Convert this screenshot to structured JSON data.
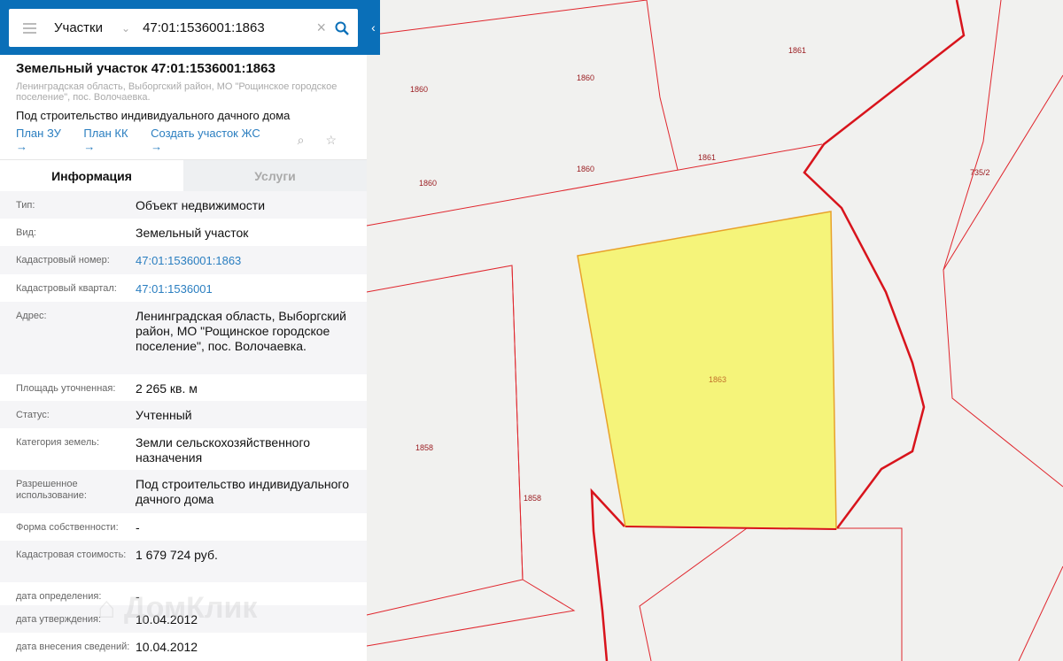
{
  "search": {
    "layer": "Участки",
    "query": "47:01:1536001:1863"
  },
  "header": {
    "title": "Земельный участок 47:01:1536001:1863",
    "address": "Ленинградская область, Выборгский район, МО \"Рощинское городское поселение\", пос. Волочаевка.",
    "purpose": "Под строительство индивидуального дачного дома",
    "links": [
      "План ЗУ →",
      "План КК →",
      "Создать участок ЖС →"
    ]
  },
  "tabs": [
    "Информация",
    "Услуги"
  ],
  "rows": [
    {
      "label": "Тип:",
      "value": "Объект недвижимости"
    },
    {
      "label": "Вид:",
      "value": "Земельный участок"
    },
    {
      "label": "Кадастровый номер:",
      "value": "47:01:1536001:1863",
      "link": true
    },
    {
      "label": "Кадастровый квартал:",
      "value": "47:01:1536001",
      "link": true
    },
    {
      "label": "Адрес:",
      "value": "Ленинградская область, Выборгский район, МО \"Рощинское городское поселение\", пос. Волочаевка."
    },
    {
      "label": "Площадь уточненная:",
      "value": "2 265 кв. м"
    },
    {
      "label": "Статус:",
      "value": "Учтенный"
    },
    {
      "label": "Категория земель:",
      "value": "Земли сельскохозяйственного назначения"
    },
    {
      "label": "Разрешенное использование:",
      "value": "Под строительство индивидуального дачного дома"
    },
    {
      "label": "Форма собственности:",
      "value": "-"
    },
    {
      "label": "Кадастровая стоимость:",
      "value": "1 679 724 руб."
    },
    {
      "label": "дата определения:",
      "value": "-"
    },
    {
      "label": "дата утверждения:",
      "value": "10.04.2012"
    },
    {
      "label": "дата внесения сведений:",
      "value": "10.04.2012"
    }
  ],
  "watermark": "ДомКлик",
  "map": {
    "labels": [
      "1861",
      "1860",
      "1860",
      "1860",
      "1861",
      "1860",
      "735/2",
      "1863",
      "1858",
      "1858"
    ],
    "highlight": "#f5f47a",
    "border": "#d8141c"
  }
}
